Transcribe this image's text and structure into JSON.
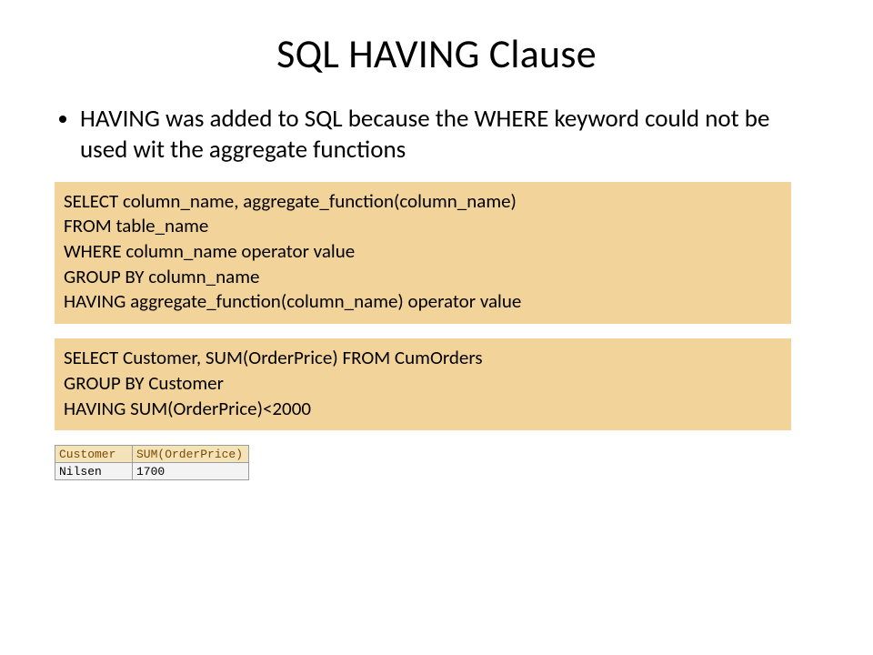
{
  "title": "SQL HAVING Clause",
  "bullet": "HAVING was added to SQL because the WHERE keyword could not be used wit the aggregate functions",
  "code1": "SELECT column_name, aggregate_function(column_name)\nFROM table_name\nWHERE column_name operator value\nGROUP BY column_name\nHAVING aggregate_function(column_name) operator value",
  "code2": "SELECT Customer, SUM(OrderPrice) FROM CumOrders\nGROUP BY Customer\nHAVING SUM(OrderPrice)<2000",
  "table": {
    "headers": {
      "a": "Customer",
      "b": "SUM(OrderPrice)"
    },
    "row": {
      "a": "Nilsen",
      "b": "1700"
    }
  }
}
